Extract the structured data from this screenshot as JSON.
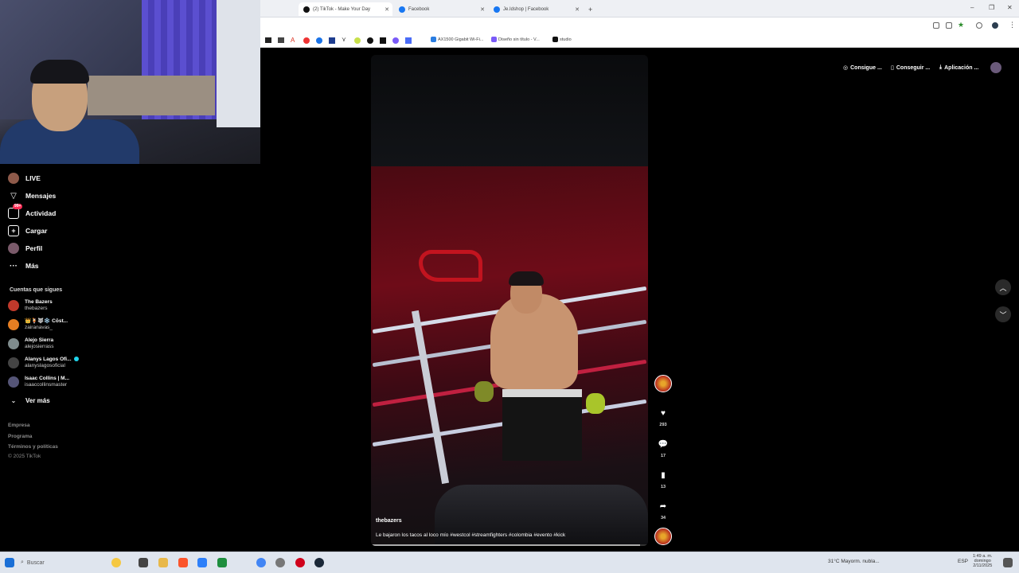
{
  "browser": {
    "tabs": [
      {
        "label": "(2) TikTok - Make Your Day",
        "active": true,
        "favicon_color": "#111111"
      },
      {
        "label": "Facebook",
        "active": false,
        "favicon_color": "#1877f2"
      },
      {
        "label": "Je.Idshop | Facebook",
        "active": false,
        "favicon_color": "#1877f2"
      }
    ],
    "new_tab": "+",
    "bookmarks": [
      {
        "label": "AX1500 Gigabit Wi-Fi...",
        "color": "#2a7de1"
      },
      {
        "label": "Diseño sin título - V...",
        "color": "#7a5af8"
      },
      {
        "label": "studio",
        "color": "#111111"
      }
    ]
  },
  "sidebar": {
    "nav": [
      {
        "label": "LIVE",
        "icon": "live-avatar-icon"
      },
      {
        "label": "Mensajes",
        "icon": "send-icon"
      },
      {
        "label": "Actividad",
        "icon": "inbox-icon",
        "badge": "99+"
      },
      {
        "label": "Cargar",
        "icon": "upload-icon"
      },
      {
        "label": "Perfil",
        "icon": "profile-avatar-icon"
      },
      {
        "label": "Más",
        "icon": "more-icon"
      }
    ],
    "following_title": "Cuentas que sigues",
    "following": [
      {
        "display": "The Bazers",
        "user": "thebazers",
        "color": "#c0392b",
        "verified": false
      },
      {
        "display": "👑🍹🐺❄️ Cōst...",
        "user": "zairanavas_",
        "color": "#e67e22",
        "verified": false
      },
      {
        "display": "Alejo Sierra",
        "user": "alejosierrass",
        "color": "#7f8c8d",
        "verified": false
      },
      {
        "display": "Alanys Lagos Ofi...",
        "user": "alanyslagosoficial",
        "color": "#444",
        "verified": true
      },
      {
        "display": "Isaac Collins | M...",
        "user": "isaaccollinsmaster",
        "color": "#555577",
        "verified": false
      }
    ],
    "see_more": "Ver más",
    "footer": [
      "Empresa",
      "Programa",
      "Términos y políticas",
      "© 2025 TikTok"
    ]
  },
  "header_actions": [
    {
      "label": "Consigue ...",
      "icon": "coin-icon"
    },
    {
      "label": "Conseguir ...",
      "icon": "phone-icon"
    },
    {
      "label": "Aplicación ...",
      "icon": "download-icon"
    }
  ],
  "video": {
    "username": "thebazers",
    "caption": "Le bajaron los tacos al loco mío #westcol #streamfighters #colombia #evento #kick",
    "progress": 0.97,
    "likes": "293",
    "comments": "17",
    "saves": "13",
    "shares": "34"
  },
  "taskbar": {
    "search_placeholder": "Buscar",
    "weather": "31°C Mayorm. nubla...",
    "lang": "ESP",
    "time": "1:49 a. m.",
    "date_day": "domingo",
    "date": "2/11/2025"
  }
}
